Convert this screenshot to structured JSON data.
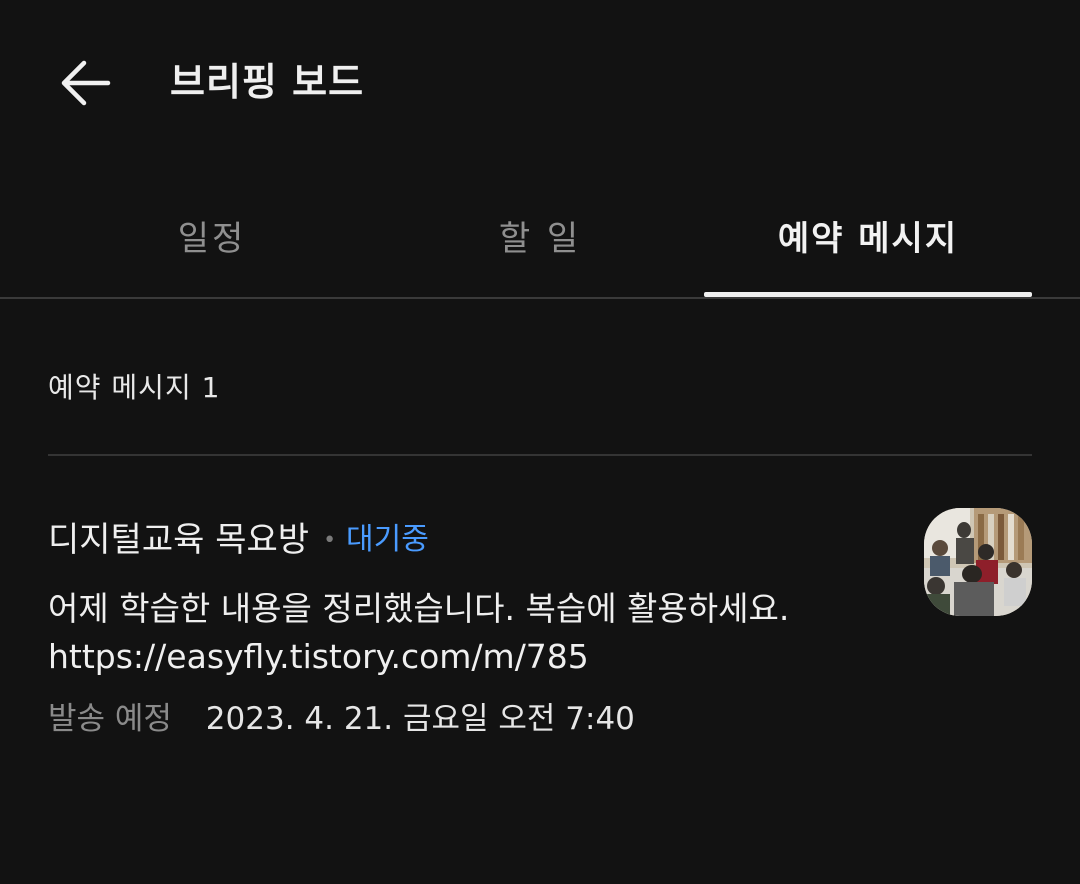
{
  "header": {
    "title": "브리핑 보드"
  },
  "tabs": [
    {
      "label": "일정",
      "active": false
    },
    {
      "label": "할 일",
      "active": false
    },
    {
      "label": "예약 메시지",
      "active": true
    }
  ],
  "section": {
    "title": "예약 메시지 1"
  },
  "messages": [
    {
      "name": "디지털교육 목요방",
      "separator": "•",
      "status": "대기중",
      "body": "어제 학습한 내용을 정리했습니다. 복습에 활용하세요.\nhttps://easyfly.tistory.com/m/785",
      "meta_label": "발송 예정",
      "meta_value": "2023. 4. 21. 금요일 오전 7:40",
      "thumbnail_icon": "group-photo-thumbnail"
    }
  ],
  "colors": {
    "background": "#121212",
    "accent_status": "#4a9bff",
    "text_primary": "#efefef",
    "text_secondary": "#8f8f8f"
  }
}
